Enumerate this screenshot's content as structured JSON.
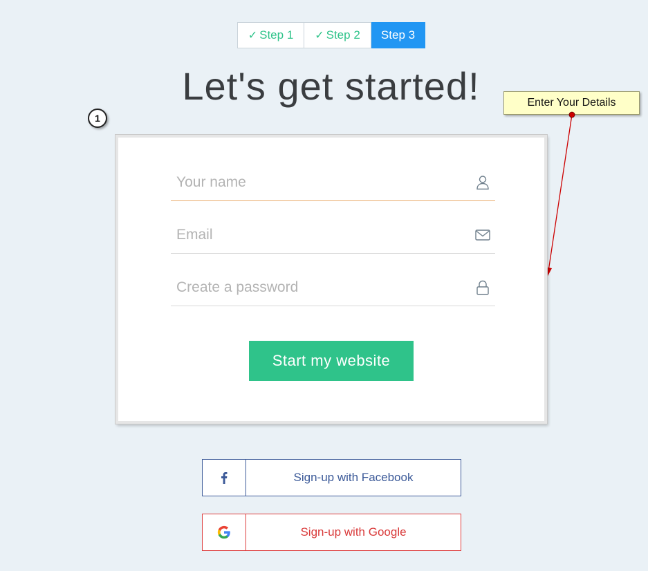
{
  "steps": [
    {
      "label": "Step 1",
      "state": "done"
    },
    {
      "label": "Step 2",
      "state": "done"
    },
    {
      "label": "Step 3",
      "state": "active"
    }
  ],
  "title": "Let's get started!",
  "annotation": {
    "badge_number": "1",
    "callout_text": "Enter Your Details"
  },
  "form": {
    "name_placeholder": "Your name",
    "email_placeholder": "Email",
    "password_placeholder": "Create a password",
    "name_value": "",
    "email_value": "",
    "password_value": "",
    "submit_label": "Start my website"
  },
  "social": {
    "facebook_label": "Sign-up with Facebook",
    "google_label": "Sign-up with Google"
  },
  "icons": {
    "check": "check-icon",
    "name": "user-icon",
    "email": "envelope-icon",
    "password": "lock-icon",
    "facebook": "facebook-icon",
    "google": "google-icon"
  },
  "colors": {
    "background": "#eaf1f6",
    "accent_green": "#2fc38a",
    "active_step_blue": "#2196f3",
    "facebook_blue": "#3b5998",
    "google_red": "#dd3b3b",
    "callout_fill": "#ffffc8",
    "arrow_red": "#cc0000"
  }
}
